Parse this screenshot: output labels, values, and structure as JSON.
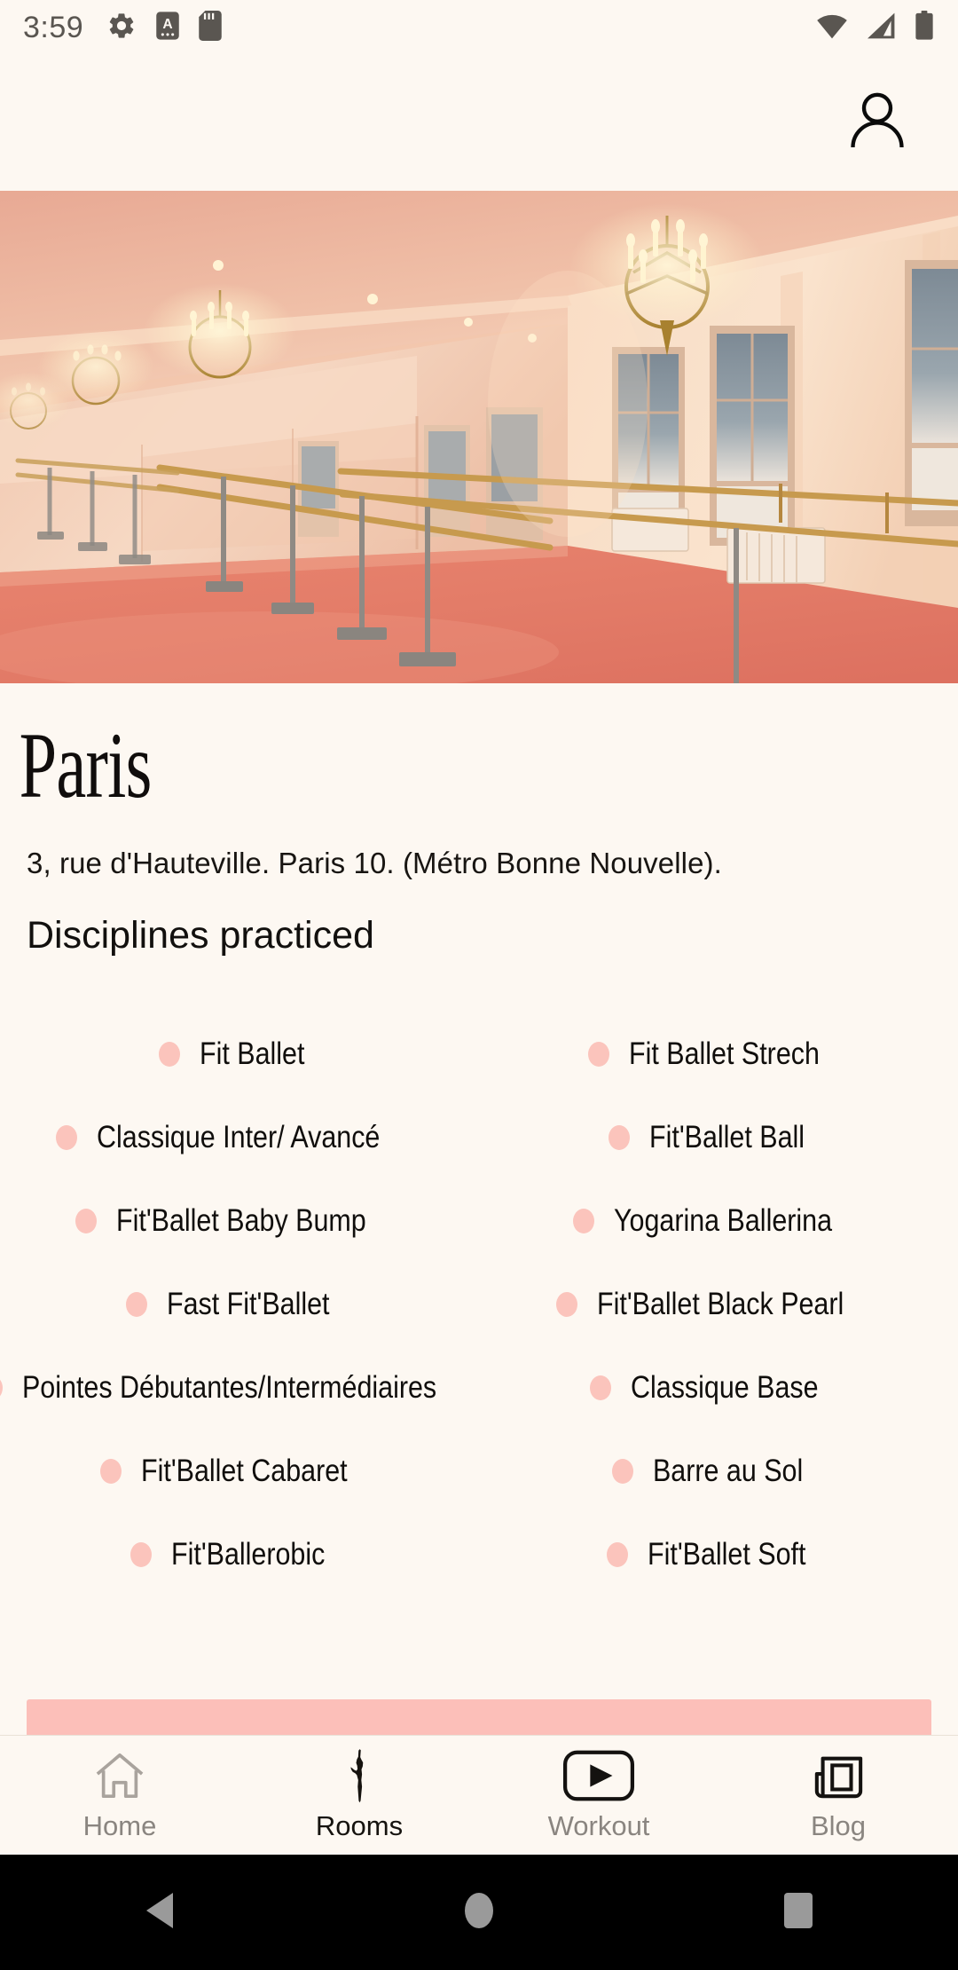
{
  "status_bar": {
    "time": "3:59",
    "left_icons": [
      "gear-icon",
      "a-badge-icon",
      "sdcard-icon"
    ],
    "right_icons": [
      "wifi-icon",
      "cellular-signal-icon",
      "battery-icon"
    ],
    "icon_color": "#5a5651"
  },
  "app_header": {
    "profile_icon": "person-icon"
  },
  "hero": {
    "alt": "ballet-studio-interior-photo"
  },
  "venue": {
    "title": "Paris",
    "address": "3, rue d'Hauteville. Paris 10. (Métro Bonne Nouvelle)."
  },
  "disciplines_section": {
    "heading": "Disciplines practiced",
    "bullet_color": "#FBC4BC",
    "items": [
      "Fit Ballet",
      "Fit Ballet Strech",
      "Classique Inter/ Avancé",
      "Fit'Ballet Ball",
      "Fit'Ballet Baby Bump",
      "Yogarina Ballerina",
      "Fast Fit'Ballet",
      "Fit'Ballet Black Pearl",
      "Pointes Débutantes/Intermédiaires",
      "Classique Base",
      "Fit'Ballet Cabaret",
      "Barre au Sol",
      "Fit'Ballerobic",
      "Fit'Ballet Soft"
    ]
  },
  "cta_bar": {
    "color": "#FCBFB9"
  },
  "bottom_nav": {
    "items": [
      {
        "label": "Home",
        "icon": "home-icon",
        "active": false
      },
      {
        "label": "Rooms",
        "icon": "ballerina-icon",
        "active": true
      },
      {
        "label": "Workout",
        "icon": "play-video-icon",
        "active": false
      },
      {
        "label": "Blog",
        "icon": "newspaper-icon",
        "active": false
      }
    ],
    "inactive_color": "#8a8580",
    "active_color": "#16130f"
  },
  "android_nav": {
    "buttons": [
      "back-button",
      "home-button",
      "recents-button"
    ],
    "icon_color": "#9a9a9a",
    "background": "#000000"
  },
  "theme": {
    "background": "#FDF8F2",
    "text": "#100e0c",
    "accent_pink": "#FBC4BC"
  }
}
